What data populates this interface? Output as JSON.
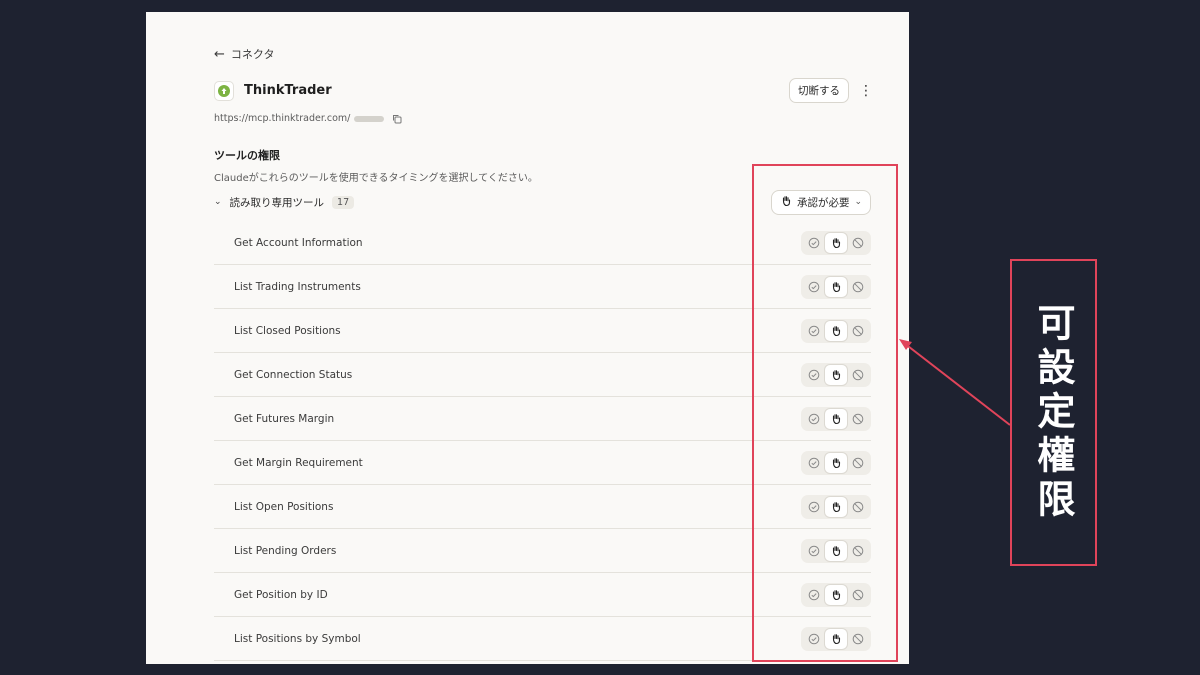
{
  "nav": {
    "back_label": "コネクタ"
  },
  "connector": {
    "name": "ThinkTrader",
    "url": "https://mcp.thinktrader.com/",
    "disconnect_label": "切断する",
    "more_icon": "more-vertical-icon",
    "logo_color": "#7cb342"
  },
  "permissions": {
    "title": "ツールの権限",
    "description": "Claudeがこれらのツールを使用できるタイミングを選択してください。",
    "group": {
      "label": "読み取り専用ツール",
      "count": "17",
      "approval_label": "承認が必要"
    },
    "tools": [
      {
        "name": "Get Account Information",
        "mode": "approval-required"
      },
      {
        "name": "List Trading Instruments",
        "mode": "approval-required"
      },
      {
        "name": "List Closed Positions",
        "mode": "approval-required"
      },
      {
        "name": "Get Connection Status",
        "mode": "approval-required"
      },
      {
        "name": "Get Futures Margin",
        "mode": "approval-required"
      },
      {
        "name": "Get Margin Requirement",
        "mode": "approval-required"
      },
      {
        "name": "List Open Positions",
        "mode": "approval-required"
      },
      {
        "name": "List Pending Orders",
        "mode": "approval-required"
      },
      {
        "name": "Get Position by ID",
        "mode": "approval-required"
      },
      {
        "name": "List Positions by Symbol",
        "mode": "approval-required"
      }
    ]
  },
  "annotation": {
    "label": "可設定權限",
    "highlight_color": "#e0445a"
  }
}
